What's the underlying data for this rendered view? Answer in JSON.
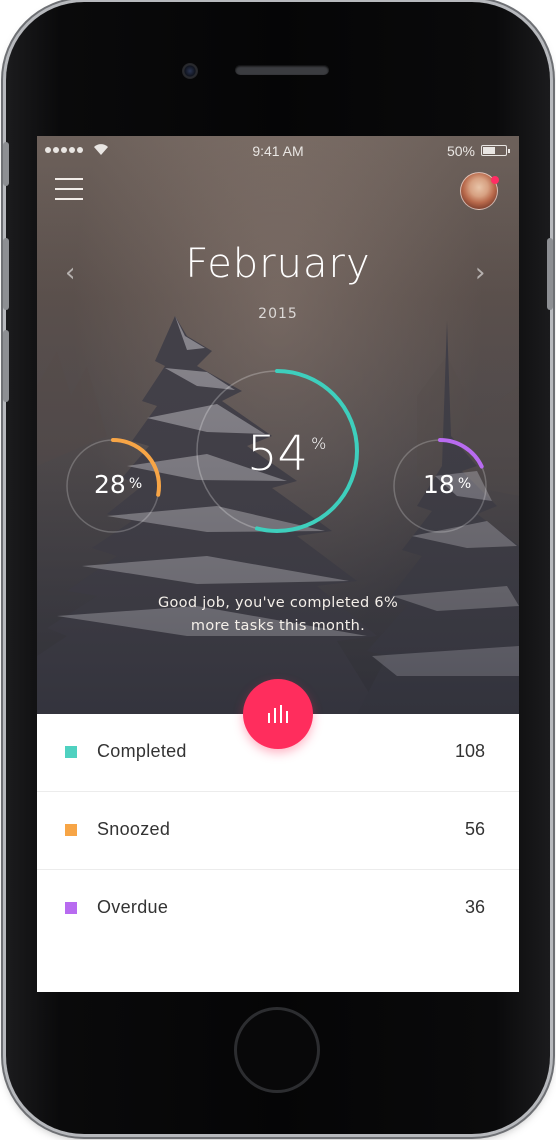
{
  "status_bar": {
    "time": "9:41 AM",
    "battery_percent": "50%",
    "battery_level": 0.5
  },
  "header": {
    "menu_icon": "hamburger-menu-icon",
    "avatar_icon": "user-avatar",
    "notification_color": "#ff2d64"
  },
  "period": {
    "month": "February",
    "year": "2015",
    "prev_icon": "chevron-left-icon",
    "next_icon": "chevron-right-icon"
  },
  "metrics": {
    "main": {
      "value": "54",
      "unit": "%",
      "fraction": 0.54,
      "color": "#3ecfbd"
    },
    "left": {
      "value": "28",
      "unit": "%",
      "fraction": 0.28,
      "color": "#f7a546"
    },
    "right": {
      "value": "18",
      "unit": "%",
      "fraction": 0.18,
      "color": "#b86bf0"
    }
  },
  "message": {
    "line1": "Good job, you've completed 6%",
    "line2": "more tasks this month."
  },
  "fab": {
    "icon": "bar-chart-icon",
    "color": "#ff2d5d"
  },
  "stats": [
    {
      "label": "Completed",
      "value": "108",
      "color": "#4fd1c0"
    },
    {
      "label": "Snoozed",
      "value": "56",
      "color": "#f7a546"
    },
    {
      "label": "Overdue",
      "value": "36",
      "color": "#b86bf0"
    }
  ]
}
